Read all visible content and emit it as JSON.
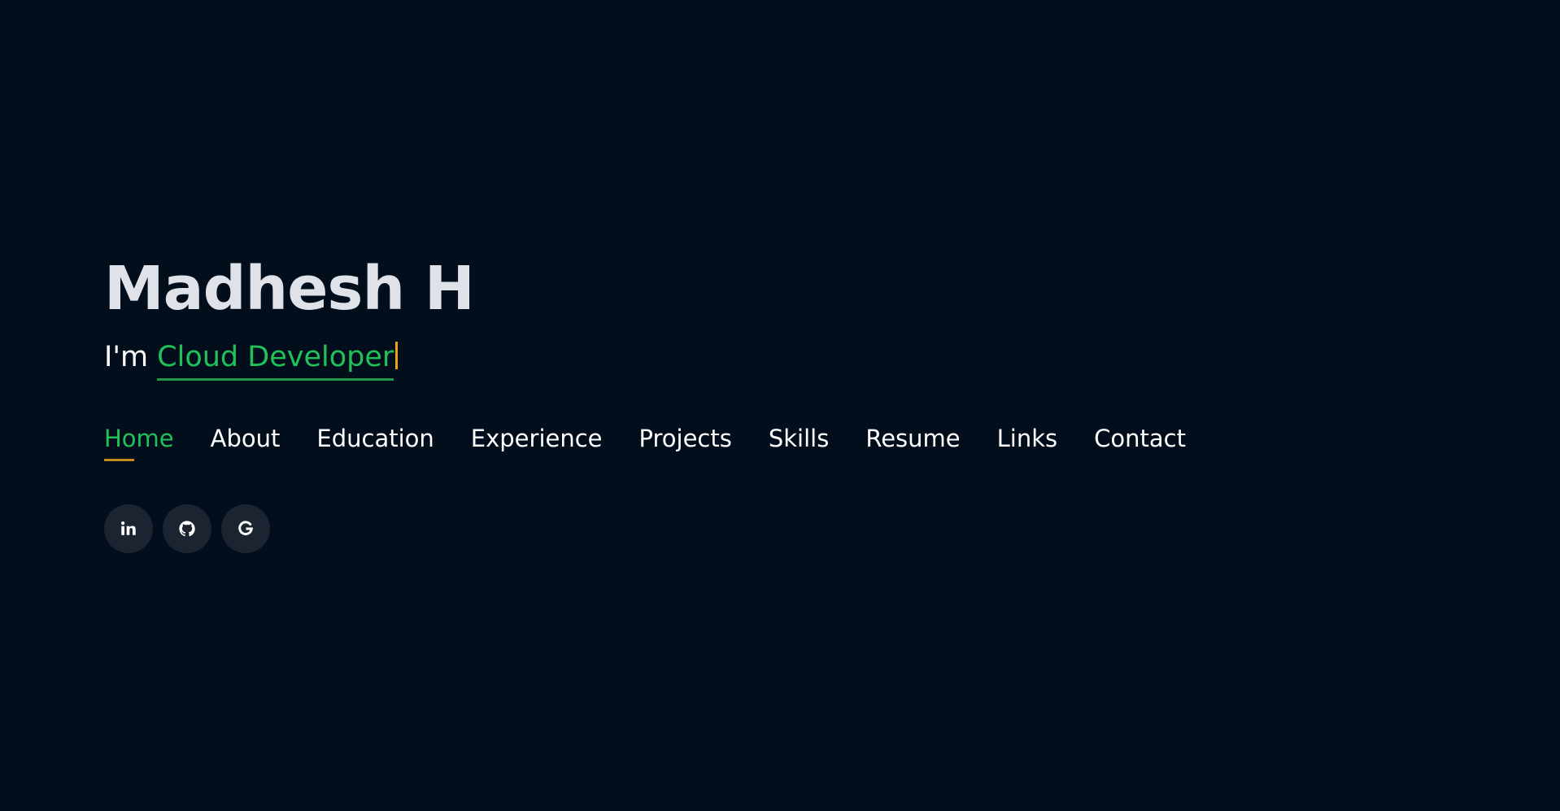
{
  "hero": {
    "name": "Madhesh H",
    "tagline_prefix": "I'm ",
    "tagline_role": "Cloud Developer"
  },
  "nav": {
    "items": [
      {
        "label": "Home",
        "active": true
      },
      {
        "label": "About"
      },
      {
        "label": "Education"
      },
      {
        "label": "Experience"
      },
      {
        "label": "Projects"
      },
      {
        "label": "Skills"
      },
      {
        "label": "Resume"
      },
      {
        "label": "Links"
      },
      {
        "label": "Contact"
      }
    ]
  },
  "socials": [
    {
      "icon": "linkedin-icon"
    },
    {
      "icon": "github-icon"
    },
    {
      "icon": "google-icon"
    }
  ],
  "colors": {
    "background": "#020e1b",
    "accent": "#21c15a",
    "underline": "#c8891e",
    "cursor": "#e8a317",
    "social_bg": "#1b2430"
  }
}
